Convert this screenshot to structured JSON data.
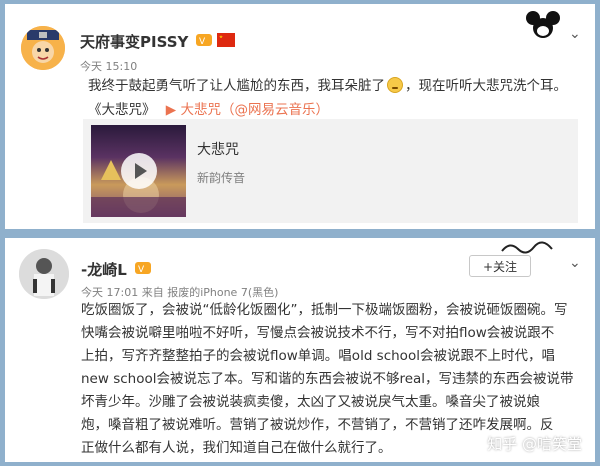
{
  "post1": {
    "user": "天府事变PISSY",
    "time": "今天 15:10",
    "text_before": "我终于鼓起勇气听了让人尴尬的东西，我耳朵脏了",
    "text_after": "，现在听听大悲咒洗个耳。",
    "song_title_quote": "《大悲咒》",
    "link_text": "▶ 大悲咒（@网易云音乐）",
    "music": {
      "title": "大悲咒",
      "artist": "新韵传音"
    }
  },
  "post2": {
    "user": "-龙崎L",
    "meta": "今天 17:01 来自 报废的iPhone 7(黑色)",
    "follow_label": "+关注",
    "lines": [
      "吃饭圈饭了，会被说“低龄化饭圈化”，抵制一下极端饭圈粉，会被说砸饭圈碗。写",
      "快嘴会被说噼里啪啦不好听，写慢点会被说技术不行，写不对拍flow会被说跟不",
      "上拍，写齐齐整整拍子的会被说flow单调。唱old school会被说跟不上时代，唱",
      "new school会被说忘了本。写和谐的东西会被说不够real，写违禁的东西会被说带",
      "坏青少年。沙雕了会被说装疯卖傻，太凶了又被说戾气太重。嗓音尖了被说娘",
      "炮，嗓音粗了被说难听。营销了被说炒作，不营销了，不营销了还咋发展啊。反",
      "正做什么都有人说，我们知道自己在做什么就行了。"
    ]
  },
  "watermark": "知乎 @唁笑堂",
  "colors": {
    "background": "#8fb0cc",
    "link": "#eb7350",
    "card": "#ffffff"
  }
}
